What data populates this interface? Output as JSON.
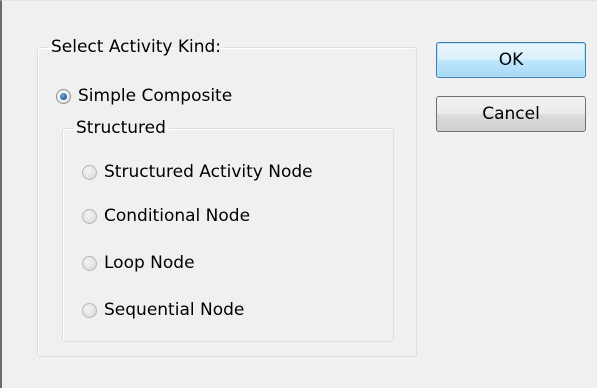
{
  "dialog": {
    "group_title": "Select Activity Kind:",
    "simple_composite": {
      "label": "Simple Composite",
      "checked": true
    },
    "structured": {
      "title": "Structured",
      "options": [
        {
          "label": "Structured Activity Node",
          "checked": false,
          "enabled": false
        },
        {
          "label": "Conditional Node",
          "checked": false,
          "enabled": false
        },
        {
          "label": "Loop Node",
          "checked": false,
          "enabled": false
        },
        {
          "label": "Sequential Node",
          "checked": false,
          "enabled": false
        }
      ]
    },
    "buttons": {
      "ok_label": "OK",
      "cancel_label": "Cancel"
    }
  },
  "colors": {
    "background": "#f0f0f0",
    "group_border": "#d5dfe5",
    "default_button_border": "#3c7fb1",
    "radio_selected_dot": "#2a63a8"
  },
  "icons": {
    "selected_radio": "radio-checked-icon",
    "unselected_radio": "radio-unchecked-icon"
  }
}
